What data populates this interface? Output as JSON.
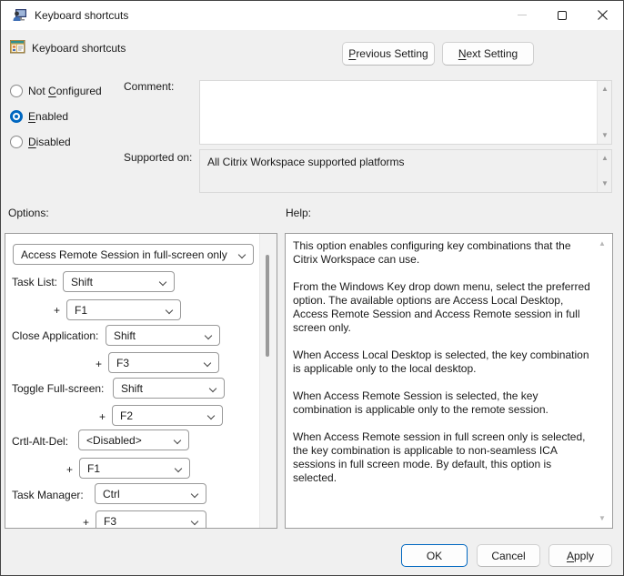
{
  "window": {
    "title": "Keyboard shortcuts"
  },
  "header": {
    "setting_name": "Keyboard shortcuts",
    "previous_button": {
      "pre": "",
      "key": "P",
      "post": "revious Setting"
    },
    "next_button": {
      "pre": "",
      "key": "N",
      "post": "ext Setting"
    }
  },
  "state": {
    "radios": [
      {
        "pre": "Not ",
        "key": "C",
        "post": "onfigured",
        "selected": false
      },
      {
        "pre": "",
        "key": "E",
        "post": "nabled",
        "selected": true
      },
      {
        "pre": "",
        "key": "D",
        "post": "isabled",
        "selected": false
      }
    ],
    "comment_label": "Comment:",
    "comment_value": "",
    "supported_label": "Supported on:",
    "supported_value": "All Citrix Workspace supported platforms"
  },
  "options_section": {
    "label": "Options:",
    "windows_key_value": "Access Remote Session in full-screen only",
    "rows": [
      {
        "label": "Task List:",
        "value": "Shift"
      },
      {
        "label": "+",
        "value": "F1"
      },
      {
        "label": "Close Application:",
        "value": "Shift"
      },
      {
        "label": "+",
        "value": "F3"
      },
      {
        "label": "Toggle Full-screen:",
        "value": "Shift"
      },
      {
        "label": "+",
        "value": "F2"
      },
      {
        "label": "Crtl-Alt-Del:",
        "value": "<Disabled>"
      },
      {
        "label": "+",
        "value": "F1"
      },
      {
        "label": "Task Manager:",
        "value": "Ctrl"
      },
      {
        "label": "+",
        "value": "F3"
      }
    ]
  },
  "help_section": {
    "label": "Help:",
    "paragraphs": [
      "This option enables configuring key combinations that the Citrix Workspace can use.",
      "From the Windows Key drop down menu, select the preferred option. The available options are Access Local Desktop, Access Remote Session and Access Remote session in full screen only.",
      "When Access Local Desktop is selected, the key combination is applicable only to the local desktop.",
      "When Access Remote Session is selected, the key combination is applicable only to the remote session.",
      "When Access Remote session in full screen only is selected, the key combination is applicable to non-seamless ICA sessions in full screen mode. By default, this option is selected."
    ]
  },
  "footer": {
    "ok": "OK",
    "cancel": "Cancel",
    "apply": {
      "pre": "",
      "key": "A",
      "post": "pply"
    }
  },
  "icons": {
    "scroll_up": "▲",
    "scroll_down": "▼"
  },
  "colors": {
    "accent": "#0067c0",
    "dialog_bg": "#f0f0f0",
    "titlebar_bg": "#ffffff",
    "panel_border": "#9d9d9d"
  }
}
